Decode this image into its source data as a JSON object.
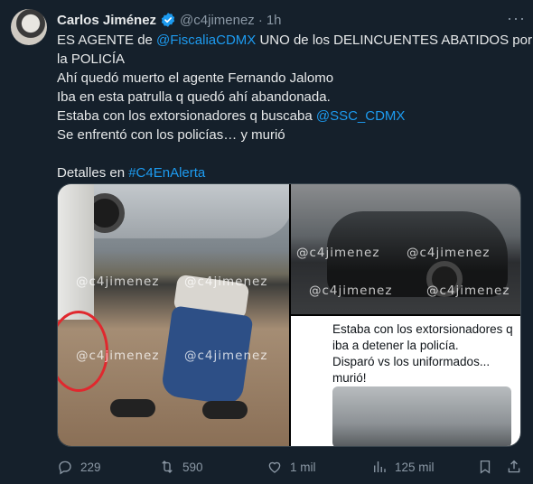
{
  "tweet": {
    "author_name": "Carlos Jiménez",
    "handle": "@c4jimenez",
    "separator": "·",
    "time": "1h",
    "more_label": "···",
    "lines": [
      [
        {
          "t": "ES AGENTE de "
        },
        {
          "t": "@FiscaliaCDMX",
          "link": true
        },
        {
          "t": " UNO de los DELINCUENTES ABATIDOS por"
        }
      ],
      [
        {
          "t": "la POLICÍA"
        }
      ],
      [
        {
          "t": "Ahí quedó muerto el agente Fernando Jalomo"
        }
      ],
      [
        {
          "t": "Iba en esta patrulla q quedó ahí abandonada."
        }
      ],
      [
        {
          "t": "Estaba con los extorsionadores q buscaba "
        },
        {
          "t": "@SSC_CDMX",
          "link": true
        }
      ],
      [
        {
          "t": "Se enfrentó con los policías… y murió"
        }
      ],
      [],
      [
        {
          "t": "Detalles en "
        },
        {
          "t": "#C4EnAlerta",
          "link": true
        }
      ]
    ]
  },
  "media": {
    "watermark": "@c4jimenez",
    "card_text": [
      "Estaba con los extorsionadores q",
      "iba a detener la policía.",
      "Disparó vs los uniformados...",
      "murió!"
    ]
  },
  "actions": {
    "replies": "229",
    "reposts": "590",
    "likes": "1 mil",
    "views": "125 mil"
  },
  "colors": {
    "background": "#15202b",
    "link": "#1d9bf0",
    "verified": "#1d9bf0",
    "muted": "#8b98a5"
  }
}
